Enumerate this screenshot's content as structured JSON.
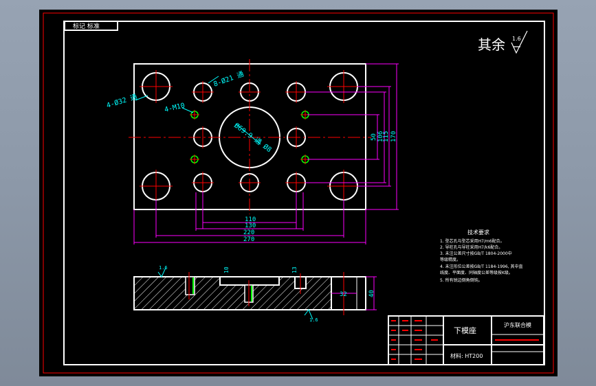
{
  "colors": {
    "background": "#000000",
    "frame": "#ffffff",
    "outer_border": "#ff0000",
    "dimension": "#ff00ff",
    "centerline": "#ff0000",
    "annotation": "#00ffff",
    "thread": "#00ff00",
    "hatch": "#ffffff"
  },
  "title_tag": "标记 标准",
  "roughness": {
    "prefix": "其余",
    "value": "1.6"
  },
  "callouts": {
    "holes_large": "4-Ø32 通",
    "holes_small": "8-Ø21 通",
    "tapped": "4-M10",
    "center_bore": "Ø69.9 通 Ø8"
  },
  "dimensions": {
    "horizontal": [
      "110",
      "130",
      "220",
      "270"
    ],
    "vertical": [
      "50",
      "106",
      "115",
      "170"
    ],
    "section_height": "40",
    "section_depth": "32",
    "section_annotation": "10",
    "section_annotation_2": "13"
  },
  "section_roughness": {
    "left": "1.6",
    "bottom": "1.6"
  },
  "tech_notes": {
    "title": "技术要求",
    "items": [
      "1. 型芯孔与型芯采用H7/m6配合。",
      "2. 导柱孔与导柱采用H7/k6配合。",
      "3. 未注公差尺寸按GB/T 1804-2000中",
      "   等级精度。",
      "4. 未注形位公差按GB/T 1184-1996, 其中直",
      "   线度、平面度、同轴度公差等级按K级。",
      "5. 所有锐边倒角倒钝。"
    ]
  },
  "title_block": {
    "part_name": "下模座",
    "company": "沪东联合模",
    "material_label": "材料: HT200"
  }
}
